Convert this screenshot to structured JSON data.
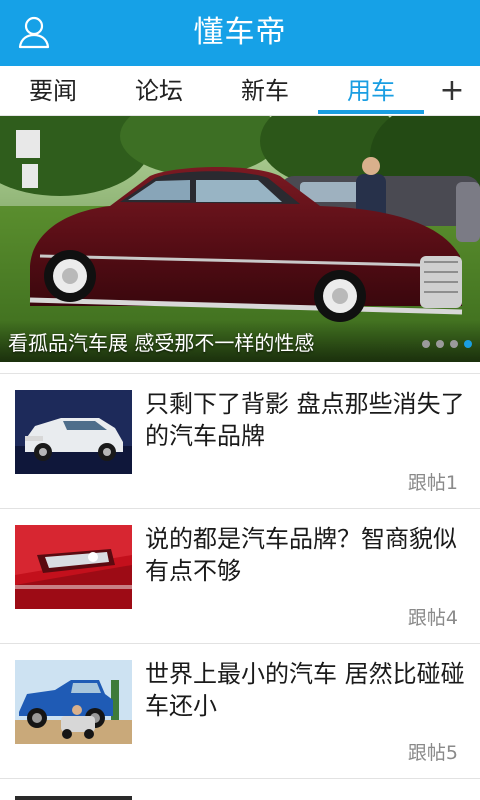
{
  "header": {
    "title": "懂车帝",
    "user_icon": "user-icon",
    "background_color": "#16a1e7"
  },
  "tabs": {
    "items": [
      {
        "label": "要闻",
        "active": false
      },
      {
        "label": "论坛",
        "active": false
      },
      {
        "label": "新车",
        "active": false
      },
      {
        "label": "用车",
        "active": true
      }
    ],
    "add_label": "+",
    "accent_color": "#1a9ee2"
  },
  "banner": {
    "caption": "看孤品汽车展 感受那不一样的性感",
    "slide_count": 4,
    "active_slide": 4
  },
  "news": [
    {
      "title": "只剩下了背影 盘点那些消失了的汽车品牌",
      "replies": "跟帖1",
      "thumb_icon": "white-suv-image"
    },
    {
      "title": "说的都是汽车品牌？智商貌似有点不够",
      "replies": "跟帖4",
      "thumb_icon": "car-headlight-image"
    },
    {
      "title": "世界上最小的汽车 居然比碰碰车还小",
      "replies": "跟帖5",
      "thumb_icon": "tiny-car-image"
    }
  ]
}
